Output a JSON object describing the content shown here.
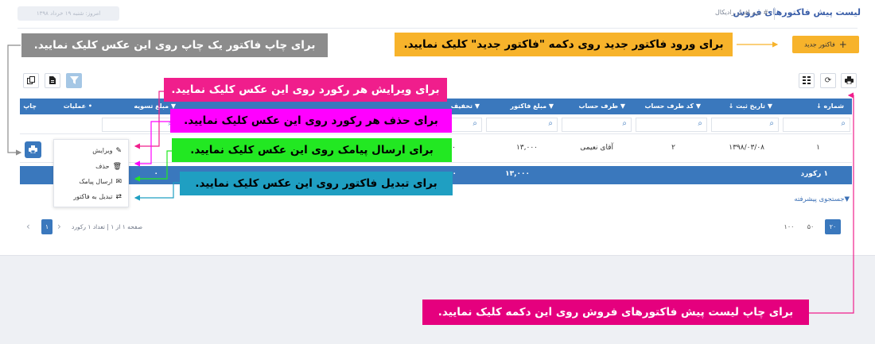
{
  "header": {
    "title": "لیست پیش فاکتورهای فروش",
    "breadcrumb": "# نرم افزار رادیکال",
    "date_badge": "امروز: شنبه ۱۹ خرداد ۱۳۹۸"
  },
  "toolbar": {
    "new_invoice_label": "فاکتور جدید"
  },
  "callouts": {
    "new_invoice": "برای ورود فاکتور جدید روی دکمه \"فاکتور جدید\" کلیک نمایید.",
    "print_single": "برای چاپ فاکتور یک چاپ روی این عکس کلیک نمایید.",
    "edit": "برای ویرایش هر رکورد روی این عکس کلیک نمایید.",
    "delete": "برای حذف هر رکورد روی این عکس کلیک نمایید.",
    "sms": "برای ارسال پیامک روی این عکس کلیک نمایید.",
    "convert": "برای تبدیل فاکتور روی این عکس کلیک نمایید.",
    "print_list": "برای چاپ لیست پیش فاکتورهای فروش روی این دکمه کلیک نمایید."
  },
  "colors": {
    "accent": "#3a78bd",
    "orange": "#f7b32b",
    "pink": "#f01e8c",
    "magenta": "#ff00ff",
    "green": "#22e822",
    "teal": "#1f9fc2",
    "gray": "#8c8c8c"
  },
  "grid": {
    "columns": {
      "number": "شماره",
      "date": "تاریخ ثبت",
      "account_code": "کد طرف حساب",
      "account": "طرف حساب",
      "amount": "مبلغ فاکتور",
      "discount": "تخفیف",
      "settlement": "مبلغ تسویه",
      "operations": "عملیات",
      "print": "چاپ"
    },
    "row": {
      "number": "۱",
      "date": "۱۳۹۸/۰۳/۰۸",
      "account_code": "۲",
      "account": "آقای نعیمی",
      "amount": "۱۳,۰۰۰",
      "discount": "۰"
    },
    "summary": {
      "count": "۱ رکورد",
      "amount": "۱۳,۰۰۰",
      "discount": "۰",
      "settlement": "۰"
    },
    "advanced_search": "جستجوی پیشرفته"
  },
  "context_menu": {
    "edit": "ویرایش",
    "delete": "حذف",
    "sms": "ارسال پیامک",
    "convert": "تبدیل به فاکتور"
  },
  "pager": {
    "info": "صفحه ۱ از ۱ | تعداد ۱ رکورد",
    "current": "۱",
    "sizes": [
      "۱۰۰",
      "۵۰",
      "۲۰"
    ]
  },
  "icons": {
    "print": "print-icon",
    "refresh": "refresh-icon",
    "columns": "columns-icon",
    "filter": "filter-icon",
    "export": "export-icon",
    "copy": "copy-icon",
    "search": "search-icon"
  }
}
